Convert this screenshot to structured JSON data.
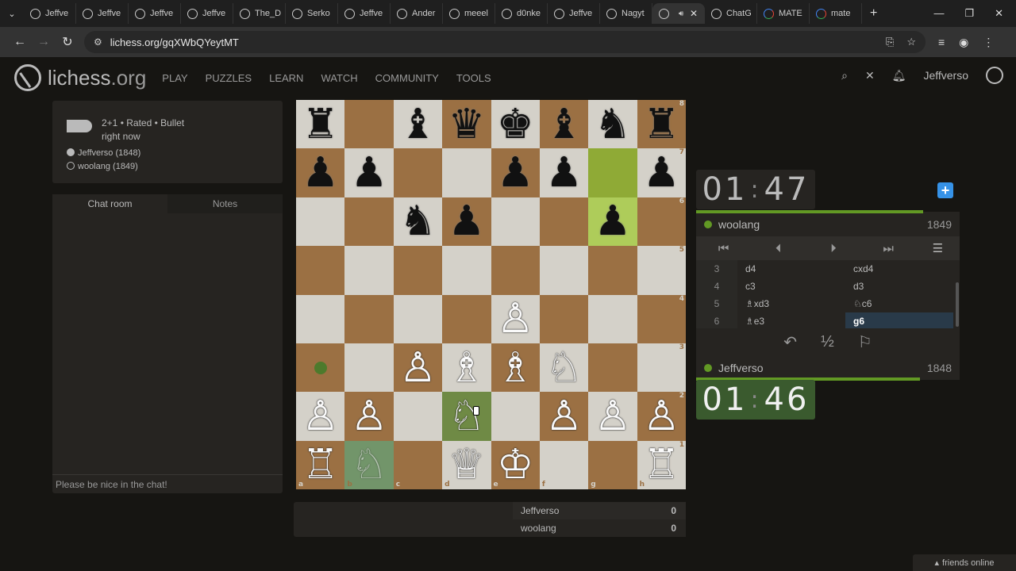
{
  "browser": {
    "tabs": [
      {
        "label": "Jeffve",
        "favicon": "lichess-icon"
      },
      {
        "label": "Jeffve",
        "favicon": "lichess-icon"
      },
      {
        "label": "Jeffve",
        "favicon": "lichess-icon"
      },
      {
        "label": "Jeffve",
        "favicon": "lichess-icon"
      },
      {
        "label": "The_D",
        "favicon": "lichess-icon"
      },
      {
        "label": "Serko",
        "favicon": "lichess-icon"
      },
      {
        "label": "Jeffve",
        "favicon": "lichess-icon"
      },
      {
        "label": "Ander",
        "favicon": "lichess-icon"
      },
      {
        "label": "meeel",
        "favicon": "lichess-icon"
      },
      {
        "label": "d0nke",
        "favicon": "lichess-icon"
      },
      {
        "label": "Jeffve",
        "favicon": "lichess-icon"
      },
      {
        "label": "Nagyt",
        "favicon": "lichess-icon"
      },
      {
        "label": "",
        "favicon": "lichess-icon",
        "active": true
      },
      {
        "label": "ChatG",
        "favicon": "chatgpt-icon"
      },
      {
        "label": "MATE",
        "favicon": "google-icon"
      },
      {
        "label": "mate",
        "favicon": "google-icon"
      }
    ],
    "url": "lichess.org/gqXWbQYeytMT"
  },
  "site": {
    "logo_main": "lichess",
    "logo_tld": ".org",
    "nav": [
      "PLAY",
      "PUZZLES",
      "LEARN",
      "WATCH",
      "COMMUNITY",
      "TOOLS"
    ],
    "username": "Jeffverso"
  },
  "game_info": {
    "line1": "2+1 • Rated • Bullet",
    "line2": "right now",
    "white": "Jeffverso (1848)",
    "black": "woolang (1849)"
  },
  "chat": {
    "tab_chat": "Chat room",
    "tab_notes": "Notes",
    "placeholder": "Please be nice in the chat!"
  },
  "board": {
    "ranks": [
      [
        "♜",
        "",
        "♝",
        "♛",
        "♚",
        "♝",
        "♞",
        "♜"
      ],
      [
        "♟",
        "♟",
        "",
        "",
        "♟",
        "♟",
        "",
        "♟"
      ],
      [
        "",
        "",
        "♞",
        "♟",
        "",
        "",
        "♟",
        ""
      ],
      [
        "",
        "",
        "",
        "",
        "",
        "",
        "",
        ""
      ],
      [
        "",
        "",
        "",
        "",
        "♙",
        "",
        "",
        ""
      ],
      [
        "",
        "",
        "♙",
        "♗",
        "♗",
        "♘",
        "",
        ""
      ],
      [
        "♙",
        "♙",
        "",
        "♘",
        "",
        "♙",
        "♙",
        "♙"
      ],
      [
        "♖",
        "♘",
        "",
        "♕",
        "♔",
        "",
        "",
        "♖"
      ]
    ],
    "rank_labels": [
      "8",
      "7",
      "6",
      "5",
      "4",
      "3",
      "2",
      "1"
    ],
    "file_labels": [
      "a",
      "b",
      "c",
      "d",
      "e",
      "f",
      "g",
      "h"
    ],
    "last_move_from": "g7",
    "last_move_to": "g6",
    "dragging_from": "b1",
    "move_dest": "a3"
  },
  "score": {
    "rows": [
      {
        "name": "Jeffverso",
        "value": "0"
      },
      {
        "name": "woolang",
        "value": "0"
      }
    ]
  },
  "clocks": {
    "top_min": "01",
    "top_sec": "47",
    "bottom_min": "01",
    "bottom_sec": "46"
  },
  "players": {
    "top": {
      "name": "woolang",
      "rating": "1849"
    },
    "bottom": {
      "name": "Jeffverso",
      "rating": "1848"
    }
  },
  "moves": [
    {
      "num": "3",
      "white": "d4",
      "black": "cxd4"
    },
    {
      "num": "4",
      "white": "c3",
      "black": "d3"
    },
    {
      "num": "5",
      "white": "♗xd3",
      "black": "♘c6"
    },
    {
      "num": "6",
      "white": "♗e3",
      "black": "g6"
    }
  ],
  "game_controls": {
    "draw_label": "½"
  },
  "friends": "friends online",
  "colors": {
    "accent_green": "#629924",
    "light_square": "#d4d1c9",
    "dark_square": "#9b7043",
    "blue": "#3692e7"
  }
}
